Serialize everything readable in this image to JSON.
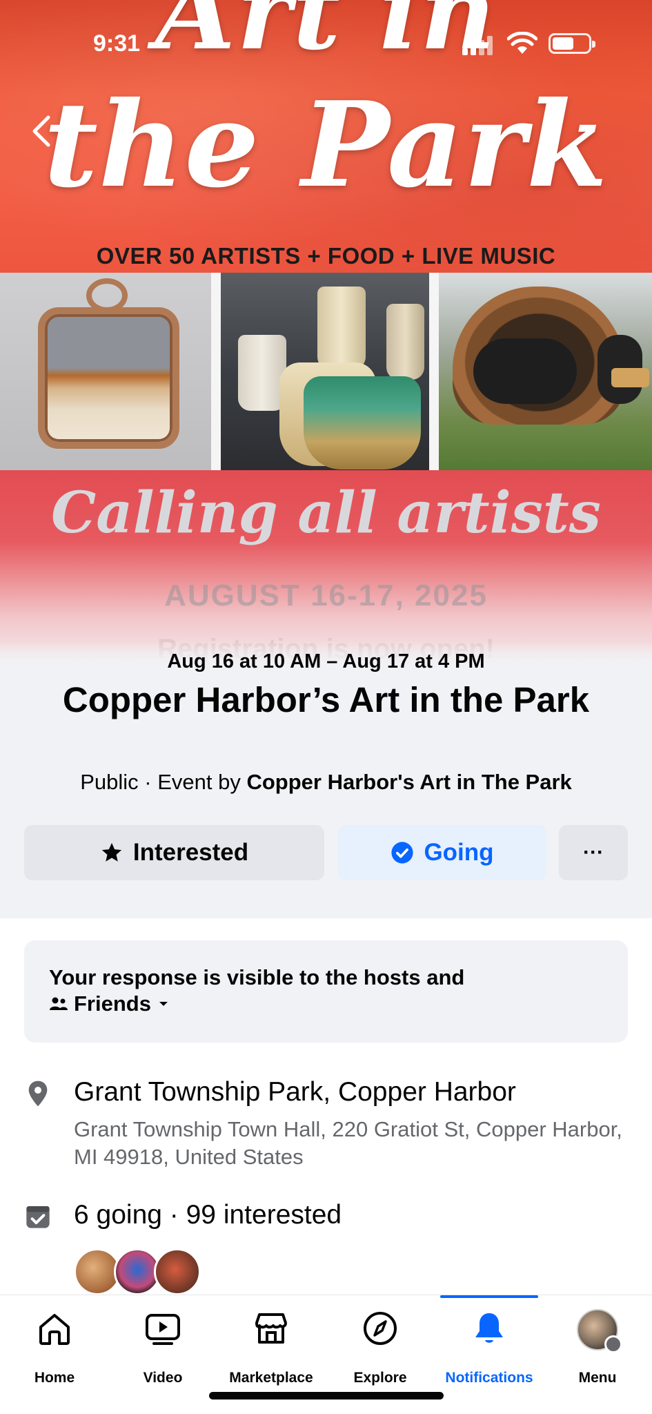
{
  "status_bar": {
    "time": "9:31"
  },
  "cover": {
    "title_line1": "Art in",
    "title_line2": "the Park",
    "subtitle": "OVER 50 ARTISTS + FOOD + LIVE MUSIC",
    "calling": "Calling all artists",
    "dates": "AUGUST 16-17, 2025",
    "registration": "Registration is now open!"
  },
  "event": {
    "date_range": "Aug 16 at 10 AM – Aug 17 at 4 PM",
    "title": "Copper Harbor’s Art in the Park",
    "privacy": "Public",
    "meta_separator": " · Event by ",
    "host": "Copper Harbor's Art in The Park"
  },
  "actions": {
    "interested_label": "Interested",
    "going_label": "Going",
    "more_label": "···"
  },
  "visibility": {
    "text": "Your response is visible to the hosts and",
    "audience": "Friends"
  },
  "location": {
    "name": "Grant Township Park, Copper Harbor",
    "address": "Grant Township Town Hall, 220 Gratiot St, Copper Harbor, MI 49918, United States"
  },
  "attendance": {
    "summary": "6 going · 99 interested"
  },
  "bottom_nav": {
    "items": [
      {
        "label": "Home",
        "icon": "home-icon"
      },
      {
        "label": "Video",
        "icon": "video-icon"
      },
      {
        "label": "Marketplace",
        "icon": "marketplace-icon"
      },
      {
        "label": "Explore",
        "icon": "compass-icon"
      },
      {
        "label": "Notifications",
        "icon": "bell-icon"
      },
      {
        "label": "Menu",
        "icon": "profile-avatar"
      }
    ],
    "active": "Notifications"
  },
  "colors": {
    "accent": "#0866ff",
    "cover_red": "#f05a3b",
    "going_bg": "#e7f0fd",
    "neutral_button": "#e4e6eb"
  }
}
